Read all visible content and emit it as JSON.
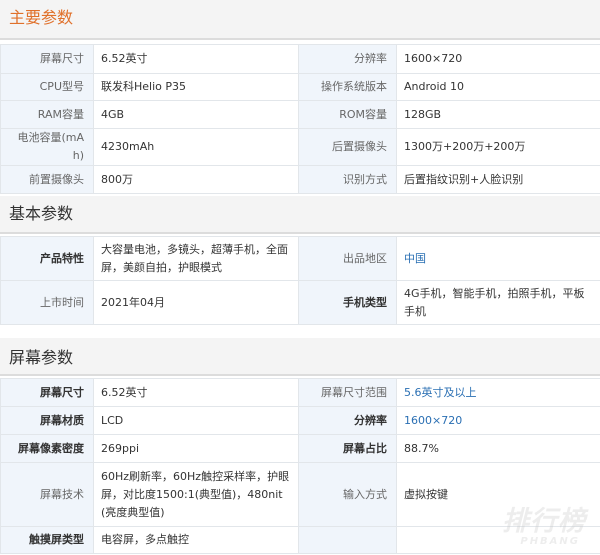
{
  "sections": [
    {
      "title": "主要参数",
      "rows": [
        [
          {
            "label": "屏幕尺寸",
            "value": "6.52英寸"
          },
          {
            "label": "分辨率",
            "value": "1600×720"
          }
        ],
        [
          {
            "label": "CPU型号",
            "value": "联发科Helio P35"
          },
          {
            "label": "操作系统版本",
            "value": "Android 10"
          }
        ],
        [
          {
            "label": "RAM容量",
            "value": "4GB"
          },
          {
            "label": "ROM容量",
            "value": "128GB"
          }
        ],
        [
          {
            "label": "电池容量(mAh)",
            "value": "4230mAh"
          },
          {
            "label": "后置摄像头",
            "value": "1300万+200万+200万"
          }
        ],
        [
          {
            "label": "前置摄像头",
            "value": "800万"
          },
          {
            "label": "识别方式",
            "value": "后置指纹识别+人脸识别"
          }
        ]
      ]
    },
    {
      "title": "基本参数",
      "rows": [
        [
          {
            "label": "产品特性",
            "value": "大容量电池，多镜头，超薄手机，全面屏，美颜自拍，护眼模式"
          },
          {
            "label": "出品地区",
            "value": "中国"
          }
        ],
        [
          {
            "label": "上市时间",
            "value": "2021年04月"
          },
          {
            "label": "手机类型",
            "value": "4G手机，智能手机，拍照手机，平板手机"
          }
        ]
      ]
    },
    {
      "title": "屏幕参数",
      "rows": [
        [
          {
            "label": "屏幕尺寸",
            "value": "6.52英寸"
          },
          {
            "label": "屏幕尺寸范围",
            "value": "5.6英寸及以上"
          }
        ],
        [
          {
            "label": "屏幕材质",
            "value": "LCD"
          },
          {
            "label": "分辨率",
            "value": "1600×720"
          }
        ],
        [
          {
            "label": "屏幕像素密度",
            "value": "269ppi"
          },
          {
            "label": "屏幕占比",
            "value": "88.7%"
          }
        ],
        [
          {
            "label": "屏幕技术",
            "value": "60Hz刷新率，60Hz触控采样率，护眼屏，对比度1500:1(典型值)，480nit(亮度典型值)"
          },
          {
            "label": "输入方式",
            "value": "虚拟按键"
          }
        ],
        [
          {
            "label": "触摸屏类型",
            "value": "电容屏，多点触控"
          },
          {
            "label": "",
            "value": ""
          }
        ]
      ]
    }
  ],
  "watermark": {
    "cn": "排行榜",
    "en": "PHBANG"
  },
  "colors": {
    "label_bg": "#f0f5fb",
    "header_bg": "#f4f4f4",
    "border": "#e2e6ea",
    "link_blue": "#2a6fb3",
    "title_orange": "#e0702a"
  }
}
